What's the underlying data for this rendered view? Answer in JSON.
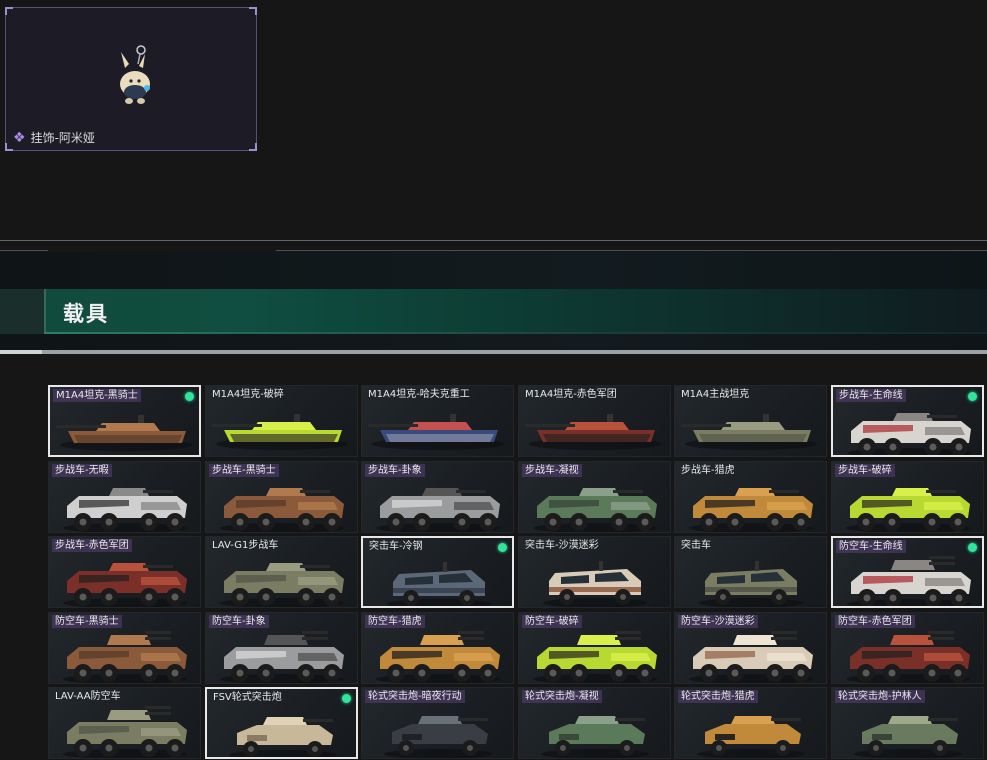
{
  "charm": {
    "label": "挂饰-阿米娅",
    "icon": "rarity-diamond-icon"
  },
  "section": {
    "title": "载具"
  },
  "colors": {
    "owned_dot": "#2ee59b",
    "selected_border": "#e8e8e8",
    "tag_bg": "#5a4078",
    "accent_green": "#124a3c"
  },
  "vehicles": [
    {
      "label": "M1A4坦克-黑骑士",
      "type": "tank",
      "skin": "copper",
      "tag": true,
      "selected": true,
      "owned": true
    },
    {
      "label": "M1A4坦克-破碎",
      "type": "tank",
      "skin": "lime",
      "tag": false,
      "selected": false,
      "owned": false
    },
    {
      "label": "M1A4坦克-哈夫克重工",
      "type": "tank",
      "skin": "blue",
      "tag": false,
      "selected": false,
      "owned": false
    },
    {
      "label": "M1A4坦克-赤色军团",
      "type": "tank",
      "skin": "red",
      "tag": false,
      "selected": false,
      "owned": false
    },
    {
      "label": "M1A4主战坦克",
      "type": "tank",
      "skin": "olive",
      "tag": false,
      "selected": false,
      "owned": false
    },
    {
      "label": "步战车-生命线",
      "type": "ifv",
      "skin": "white-red",
      "tag": true,
      "selected": true,
      "owned": true
    },
    {
      "label": "步战车-无暇",
      "type": "ifv",
      "skin": "camo-bw",
      "tag": true,
      "selected": false,
      "owned": false
    },
    {
      "label": "步战车-黑骑士",
      "type": "ifv",
      "skin": "copper",
      "tag": true,
      "selected": false,
      "owned": false
    },
    {
      "label": "步战车-卦象",
      "type": "ifv",
      "skin": "grey",
      "tag": true,
      "selected": false,
      "owned": false
    },
    {
      "label": "步战车-凝视",
      "type": "ifv",
      "skin": "green-camo",
      "tag": true,
      "selected": false,
      "owned": false
    },
    {
      "label": "步战车-猎虎",
      "type": "ifv",
      "skin": "tiger",
      "tag": false,
      "selected": false,
      "owned": false
    },
    {
      "label": "步战车-破碎",
      "type": "ifv",
      "skin": "lime",
      "tag": true,
      "selected": false,
      "owned": false
    },
    {
      "label": "步战车-赤色军团",
      "type": "ifv",
      "skin": "red",
      "tag": true,
      "selected": false,
      "owned": false
    },
    {
      "label": "LAV-G1步战车",
      "type": "ifv",
      "skin": "olive",
      "tag": false,
      "selected": false,
      "owned": false
    },
    {
      "label": "突击车-冷钢",
      "type": "suv",
      "skin": "steel",
      "tag": false,
      "selected": true,
      "owned": true
    },
    {
      "label": "突击车-沙漠迷彩",
      "type": "suv",
      "skin": "desert",
      "tag": false,
      "selected": false,
      "owned": false
    },
    {
      "label": "突击车",
      "type": "suv",
      "skin": "olive",
      "tag": false,
      "selected": false,
      "owned": false
    },
    {
      "label": "防空车-生命线",
      "type": "aa",
      "skin": "white-red",
      "tag": true,
      "selected": true,
      "owned": true
    },
    {
      "label": "防空车-黑骑士",
      "type": "aa",
      "skin": "copper",
      "tag": true,
      "selected": false,
      "owned": false
    },
    {
      "label": "防空车-卦象",
      "type": "aa",
      "skin": "grey",
      "tag": true,
      "selected": false,
      "owned": false
    },
    {
      "label": "防空车-猎虎",
      "type": "aa",
      "skin": "tiger",
      "tag": true,
      "selected": false,
      "owned": false
    },
    {
      "label": "防空车-破碎",
      "type": "aa",
      "skin": "lime",
      "tag": true,
      "selected": false,
      "owned": false
    },
    {
      "label": "防空车-沙漠迷彩",
      "type": "aa",
      "skin": "desert",
      "tag": true,
      "selected": false,
      "owned": false
    },
    {
      "label": "防空车-赤色军团",
      "type": "aa",
      "skin": "red",
      "tag": true,
      "selected": false,
      "owned": false
    },
    {
      "label": "LAV-AA防空车",
      "type": "aa",
      "skin": "olive",
      "tag": false,
      "selected": false,
      "owned": false
    },
    {
      "label": "FSV轮式突击炮",
      "type": "fsv",
      "skin": "sand",
      "tag": false,
      "selected": true,
      "owned": true
    },
    {
      "label": "轮式突击炮-暗夜行动",
      "type": "fsv",
      "skin": "dark",
      "tag": true,
      "selected": false,
      "owned": false
    },
    {
      "label": "轮式突击炮-凝视",
      "type": "fsv",
      "skin": "green-camo",
      "tag": true,
      "selected": false,
      "owned": false
    },
    {
      "label": "轮式突击炮-猎虎",
      "type": "fsv",
      "skin": "tiger",
      "tag": true,
      "selected": false,
      "owned": false
    },
    {
      "label": "轮式突击炮-护林人",
      "type": "fsv",
      "skin": "forest",
      "tag": true,
      "selected": false,
      "owned": false
    }
  ]
}
